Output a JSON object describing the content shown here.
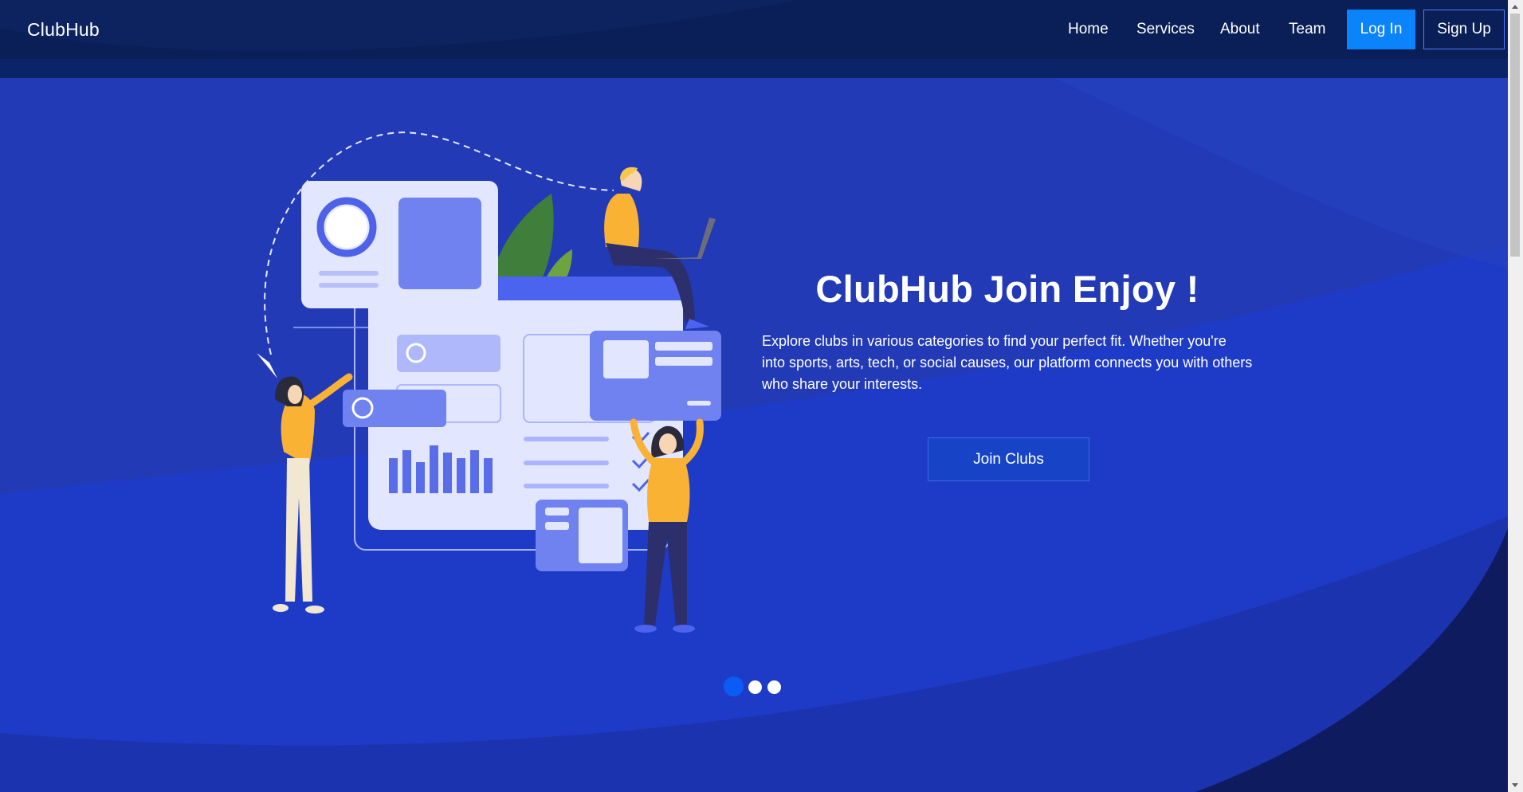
{
  "nav": {
    "brand": "ClubHub",
    "links": [
      {
        "label": "Home"
      },
      {
        "label": "Services"
      },
      {
        "label": "About"
      },
      {
        "label": "Team"
      }
    ],
    "login_label": "Log In",
    "signup_label": "Sign Up"
  },
  "hero": {
    "title": "ClubHub Join Enjoy !",
    "description": "Explore clubs in various categories to find your perfect fit. Whether you're into sports, arts, tech, or social causes, our platform connects you with others who share your interests.",
    "cta_label": "Join Clubs",
    "illustration": "people-building-dashboard-illustration"
  },
  "carousel": {
    "slide_count": 3,
    "active_slide": 1
  },
  "colors": {
    "background": "#1f36b8",
    "nav_background": "#0a1f57",
    "login_button": "#0b83fb",
    "active_dot": "#0b5cf5",
    "accent_yellow": "#f9b233"
  }
}
